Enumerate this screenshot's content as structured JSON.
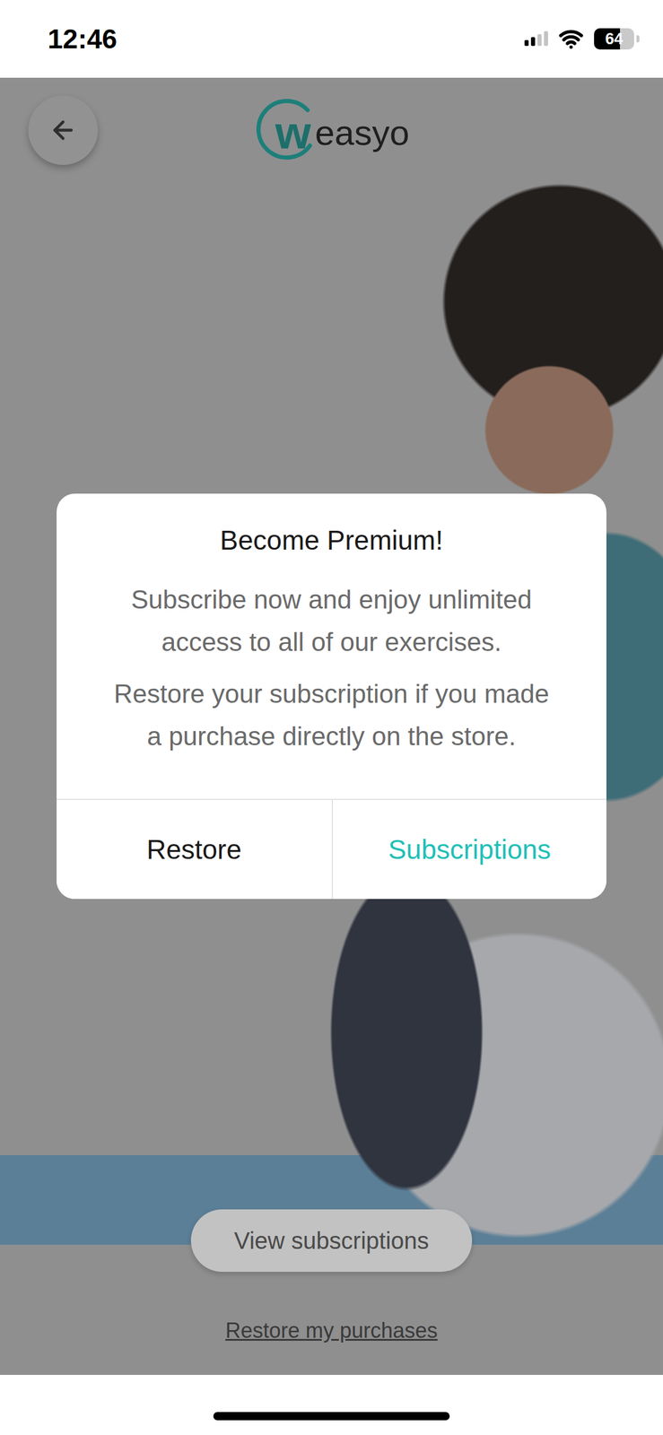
{
  "status_bar": {
    "time": "12:46",
    "signal_level": 0.5,
    "battery": "64",
    "battery_level": 0.64
  },
  "header": {
    "logo": {
      "mark": "w",
      "text": "easyo"
    }
  },
  "page": {
    "primary_button": "View subscriptions",
    "link": "Restore my purchases"
  },
  "dialog": {
    "title": "Become Premium!",
    "messages": [
      "Subscribe now and enjoy unlimited access to all of our exercises.",
      "Restore your subscription if you made a purchase directly on the store."
    ],
    "buttons": [
      {
        "label": "Restore",
        "primary": false
      },
      {
        "label": "Subscriptions",
        "primary": true
      }
    ]
  }
}
